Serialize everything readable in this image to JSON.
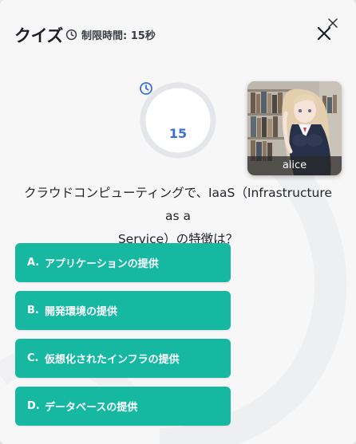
{
  "header": {
    "title": "クイズ",
    "timer_label": "制限時間: 15秒"
  },
  "timer": {
    "remaining": "15"
  },
  "avatar": {
    "name": "alice"
  },
  "question": {
    "line1": "クラウドコンピューティングで、IaaS（Infrastructure as a",
    "line2": "Service）の特徴は？"
  },
  "options": [
    {
      "letter": "A.",
      "text": "アプリケーションの提供"
    },
    {
      "letter": "B.",
      "text": "開発環境の提供"
    },
    {
      "letter": "C.",
      "text": "仮想化されたインフラの提供"
    },
    {
      "letter": "D.",
      "text": "データベースの提供"
    }
  ],
  "colors": {
    "accent": "#17b8a2",
    "timer_blue": "#3e6fd6",
    "ring_track": "#e5e6ea"
  }
}
